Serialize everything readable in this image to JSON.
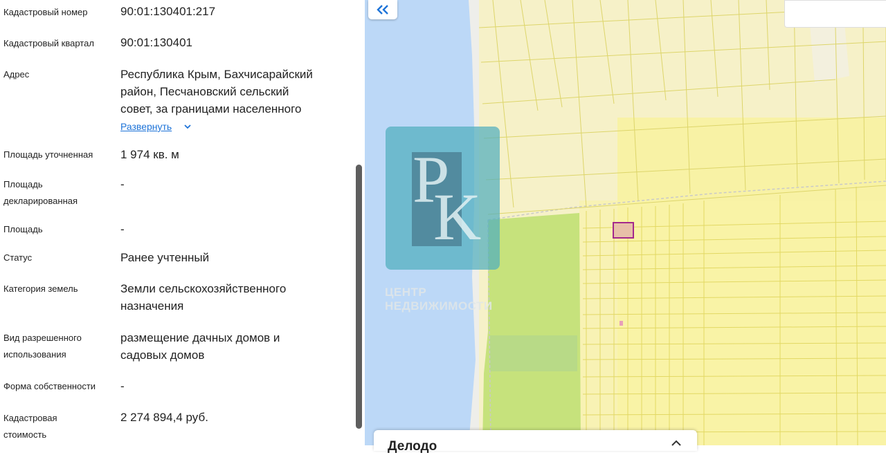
{
  "details": {
    "cadastral_number": {
      "label": "Кадастровый номер",
      "value": "90:01:130401:217"
    },
    "cadastral_quarter": {
      "label": "Кадастровый квартал",
      "value": "90:01:130401"
    },
    "address": {
      "label": "Адрес",
      "lines": [
        "Республика Крым, Бахчисарайский",
        "район, Песчановский сельский",
        "совет, за границами населенного"
      ],
      "expand_label": "Развернуть"
    },
    "area_refined": {
      "label": "Площадь уточненная",
      "value": "1 974 кв. м"
    },
    "area_declared": {
      "label_lines": [
        "Площадь",
        "декларированная"
      ],
      "value": "-"
    },
    "area": {
      "label": "Площадь",
      "value": "-"
    },
    "status": {
      "label": "Статус",
      "value": "Ранее учтенный"
    },
    "land_category": {
      "label": "Категория земель",
      "value_lines": [
        "Земли сельскохозяйственного",
        "назначения"
      ]
    },
    "permitted_use": {
      "label_lines": [
        "Вид разрешенного",
        "использования"
      ],
      "value_lines": [
        "размещение дачных домов и",
        "садовых домов"
      ]
    },
    "ownership": {
      "label": "Форма собственности",
      "value": "-"
    },
    "cadastral_value": {
      "label_lines": [
        "Кадастровая",
        "стоимость"
      ],
      "value": "2 274 894,4 руб."
    }
  },
  "map": {
    "collapse_icon": "double-chevron-left-icon",
    "watermark": {
      "letters": [
        "P",
        "K"
      ],
      "text_lines": [
        "ЦЕНТР",
        "НЕДВИЖИМОСТИ"
      ]
    },
    "bottom_card_title": "Делодо"
  },
  "colors": {
    "link": "#1d73d8",
    "water": "#bcd8f7",
    "parcel_fill": "#f6f1c8",
    "parcel_line": "#ddd56a",
    "green_zone": "#c6e27c",
    "selected_parcel": "#a4288c"
  }
}
